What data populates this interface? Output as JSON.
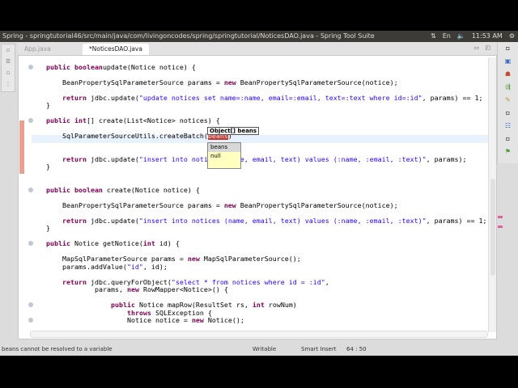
{
  "window": {
    "title": "Spring - springtutorial46/src/main/java/com/livingoncodes/spring/springtutorial/NoticesDAO.java - Spring Tool Suite",
    "clock": "11:53 AM",
    "keyboard": "En"
  },
  "tabs": [
    {
      "label": "App.java",
      "active": false
    },
    {
      "label": "*NoticesDAO.java",
      "active": true
    }
  ],
  "code": [
    {
      "row": 0,
      "indent": 1,
      "segs": [
        [
          "kw",
          "public boolean"
        ],
        [
          "",
          "update(Notice notice) {"
        ]
      ]
    },
    {
      "row": 2,
      "indent": 2,
      "segs": [
        [
          "",
          "BeanPropertySqlParameterSource params = "
        ],
        [
          "kw",
          "new"
        ],
        [
          "",
          " BeanPropertySqlParameterSource(notice);"
        ]
      ]
    },
    {
      "row": 4,
      "indent": 2,
      "segs": [
        [
          "kw",
          "return"
        ],
        [
          "",
          " jdbc.update("
        ],
        [
          "str",
          "\"update notices set name=:name, email=:email, text=:text where id=:id\""
        ],
        [
          "",
          ", params) == 1;"
        ]
      ]
    },
    {
      "row": 5,
      "indent": 1,
      "segs": [
        [
          "",
          "}"
        ]
      ]
    },
    {
      "row": 7,
      "indent": 1,
      "segs": [
        [
          "kw",
          "public int"
        ],
        [
          "",
          "[] create(List<Notice> notices) {"
        ]
      ]
    },
    {
      "row": 9,
      "indent": 2,
      "segs": [
        [
          "",
          "SqlParameterSourceUtils.createBatch("
        ],
        [
          "sel",
          "beans"
        ],
        [
          "",
          ")"
        ]
      ]
    },
    {
      "row": 12,
      "indent": 2,
      "segs": [
        [
          "kw",
          "return"
        ],
        [
          "",
          " jdbc.update("
        ],
        [
          "str",
          "\"insert into notices (name, email, text) values (:name, :email, :text)\""
        ],
        [
          "",
          ", params);"
        ]
      ]
    },
    {
      "row": 13,
      "indent": 1,
      "segs": [
        [
          "",
          "}"
        ]
      ]
    },
    {
      "row": 16,
      "indent": 1,
      "segs": [
        [
          "kw",
          "public boolean"
        ],
        [
          "",
          " create(Notice notice) {"
        ]
      ]
    },
    {
      "row": 18,
      "indent": 2,
      "segs": [
        [
          "",
          "BeanPropertySqlParameterSource params = "
        ],
        [
          "kw",
          "new"
        ],
        [
          "",
          " BeanPropertySqlParameterSource(notice);"
        ]
      ]
    },
    {
      "row": 20,
      "indent": 2,
      "segs": [
        [
          "kw",
          "return"
        ],
        [
          "",
          " jdbc.update("
        ],
        [
          "str",
          "\"insert into notices (name, email, text) values (:name, :email, :text)\""
        ],
        [
          "",
          ", params) == 1;"
        ]
      ]
    },
    {
      "row": 21,
      "indent": 1,
      "segs": [
        [
          "",
          "}"
        ]
      ]
    },
    {
      "row": 23,
      "indent": 1,
      "segs": [
        [
          "kw",
          "public"
        ],
        [
          "",
          " Notice getNotice("
        ],
        [
          "kw",
          "int"
        ],
        [
          "",
          " id) {"
        ]
      ]
    },
    {
      "row": 25,
      "indent": 2,
      "segs": [
        [
          "",
          "MapSqlParameterSource params = "
        ],
        [
          "kw",
          "new"
        ],
        [
          "",
          " MapSqlParameterSource();"
        ]
      ]
    },
    {
      "row": 26,
      "indent": 2,
      "segs": [
        [
          "",
          "params.addValue("
        ],
        [
          "str",
          "\"id\""
        ],
        [
          "",
          ", id);"
        ]
      ]
    },
    {
      "row": 28,
      "indent": 2,
      "segs": [
        [
          "kw",
          "return"
        ],
        [
          "",
          " jdbc.queryForObject("
        ],
        [
          "str",
          "\"select * from notices where id = :id\""
        ],
        [
          "",
          ","
        ]
      ]
    },
    {
      "row": 29,
      "indent": 4,
      "segs": [
        [
          "",
          "params, "
        ],
        [
          "kw",
          "new"
        ],
        [
          "",
          " RowMapper<Notice>() {"
        ]
      ]
    },
    {
      "row": 31,
      "indent": 5,
      "segs": [
        [
          "kw",
          "public"
        ],
        [
          "",
          " Notice mapRow(ResultSet rs, "
        ],
        [
          "kw",
          "int"
        ],
        [
          "",
          " rowNum)"
        ]
      ]
    },
    {
      "row": 32,
      "indent": 6,
      "segs": [
        [
          "kw",
          "throws"
        ],
        [
          "",
          " SQLException {"
        ]
      ]
    },
    {
      "row": 33,
      "indent": 6,
      "segs": [
        [
          "",
          "Notice notice = "
        ],
        [
          "kw",
          "new"
        ],
        [
          "",
          " Notice();"
        ]
      ]
    }
  ],
  "tooltip": "Object[] beans",
  "completion": [
    "beans",
    "null"
  ],
  "status": {
    "message": "beans cannot be resolved to a variable",
    "mode": "Writable",
    "insert": "Smart Insert",
    "position": "64 : 50"
  }
}
